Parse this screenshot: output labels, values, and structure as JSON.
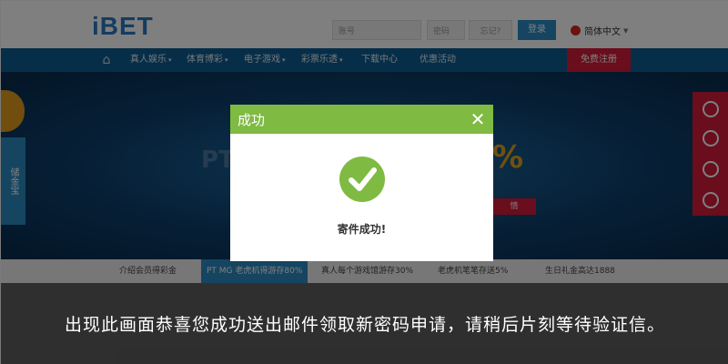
{
  "site": {
    "logo": "iBET",
    "login": {
      "user_placeholder": "账号",
      "pass_placeholder": "密码",
      "forgot_label": "忘记?",
      "login_button": "登录"
    },
    "language": "简体中文",
    "nav": {
      "items": [
        "真人娱乐",
        "体育博彩",
        "电子游戏",
        "彩票乐透",
        "下载中心",
        "优惠活动"
      ],
      "signup_button": "免费注册"
    },
    "banner": {
      "headline_left": "PT",
      "headline_right": "%",
      "cta": "情",
      "side_tab": "储金宝"
    },
    "promos": [
      "介绍会员得彩金",
      "PT MG 老虎机得游存80%",
      "真人每个游戏馆游存30%",
      "老虎机笔笔存送5%",
      "生日礼金高达1888"
    ]
  },
  "modal": {
    "title": "成功",
    "message": "寄件成功!",
    "header_color": "#7fba42"
  },
  "caption": {
    "text": "出现此画面恭喜您成功送出邮件领取新密码申请，请稍后片刻等待验证信。"
  },
  "icons": {
    "home": "home-icon",
    "close": "close-icon",
    "success": "checkmark-icon",
    "side": [
      "headset-icon",
      "chat-icon",
      "wechat-icon",
      "phone-icon"
    ]
  }
}
